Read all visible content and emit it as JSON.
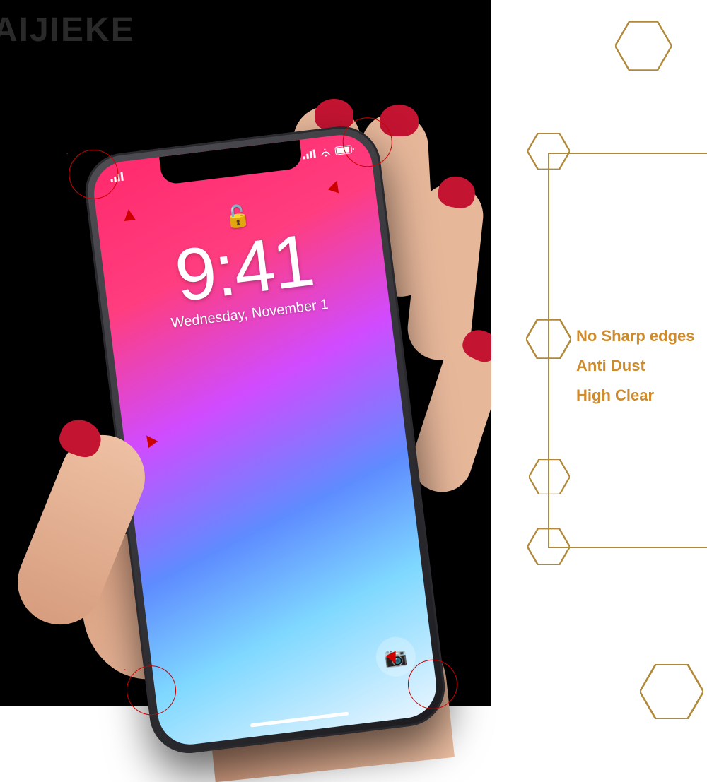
{
  "watermark": "AIJIEKE",
  "phone": {
    "carrier_signal": "signal",
    "time": "9:41",
    "date": "Wednesday, November 1"
  },
  "features": {
    "line1": "No Sharp edges",
    "line2": "Anti Dust",
    "line3": "High Clear"
  },
  "colors": {
    "gold": "#b1893a",
    "accent_text": "#cc8b2e"
  }
}
